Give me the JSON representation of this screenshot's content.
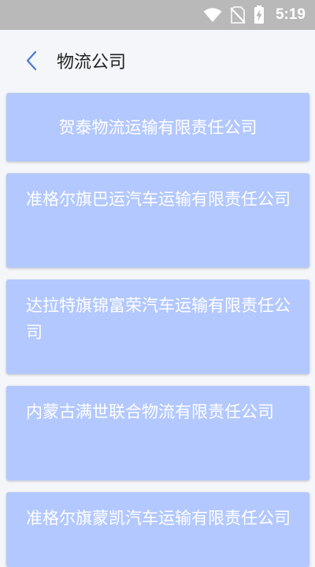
{
  "status_bar": {
    "time": "5:19",
    "icons": [
      "wifi-icon",
      "no-sim-icon",
      "battery-charging-icon"
    ]
  },
  "header": {
    "title": "物流公司",
    "back_icon": "chevron-left-icon"
  },
  "colors": {
    "card_background": "#b3c8ff",
    "card_text": "#ffffff",
    "accent": "#4a78d4",
    "page_background": "#f5f6fa",
    "status_bar": "#b9b9b9"
  },
  "companies": [
    {
      "name": "贺泰物流运输有限责任公司"
    },
    {
      "name": "准格尔旗巴运汽车运输有限责任公司"
    },
    {
      "name": "达拉特旗锦富荣汽车运输有限责任公司"
    },
    {
      "name": "内蒙古满世联合物流有限责任公司"
    },
    {
      "name": "准格尔旗蒙凯汽车运输有限责任公司"
    }
  ]
}
